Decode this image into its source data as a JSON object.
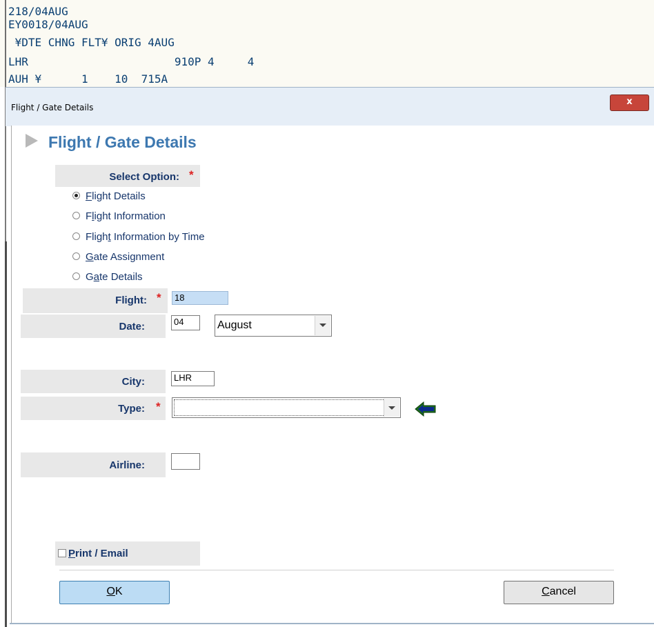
{
  "terminal": {
    "lines": [
      "218/04AUG",
      "EY0018/04AUG",
      " ¥DTE CHNG FLT¥ ORIG 4AUG",
      "LHR                      910P 4     4",
      "AUH ¥      1    10  715A"
    ]
  },
  "window": {
    "title": "Flight / Gate Details",
    "close_label": "x"
  },
  "form": {
    "heading": "Flight / Gate Details",
    "select_option_label": "Select Option:",
    "required_mark": "*",
    "options": [
      {
        "pre": "",
        "u": "F",
        "post": "light Details",
        "selected": true
      },
      {
        "pre": "F",
        "u": "l",
        "post": "ight Information",
        "selected": false
      },
      {
        "pre": "Fligh",
        "u": "t",
        "post": " Information by Time",
        "selected": false
      },
      {
        "pre": "",
        "u": "G",
        "post": "ate Assignment",
        "selected": false
      },
      {
        "pre": "G",
        "u": "a",
        "post": "te Details",
        "selected": false
      }
    ],
    "flight_label": "Flight:",
    "flight_value": "18",
    "date_label": "Date:",
    "date_day": "04",
    "date_month": "August",
    "city_label": "City:",
    "city_value": "LHR",
    "type_label": "Type:",
    "type_value": "",
    "airline_label": "Airline:",
    "airline_value": "",
    "print_email_u": "P",
    "print_email_rest": "rint / Email",
    "print_email_checked": false
  },
  "buttons": {
    "ok_u": "O",
    "ok_rest": "K",
    "cancel_u": "C",
    "cancel_rest": "ancel"
  },
  "colors": {
    "heading": "#3d78b0",
    "label": "#17366b",
    "required": "#dd2222",
    "highlight_input": "#c6def5",
    "back_icon": "#1e6b1e"
  }
}
